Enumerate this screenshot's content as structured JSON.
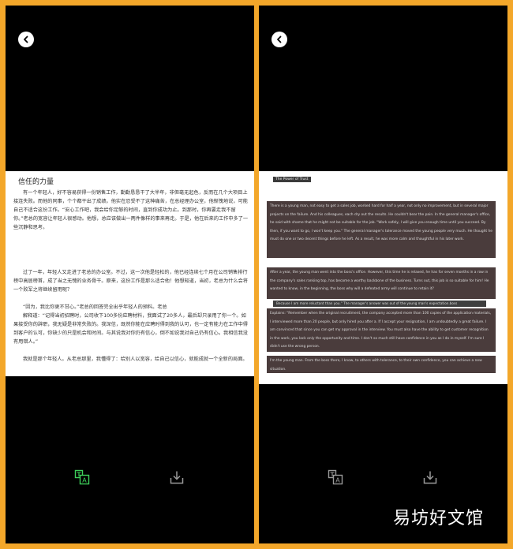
{
  "left": {
    "doc_title": "信任的力量",
    "paragraphs": [
      "有一个年轻人，好不容易获得一份销售工作，勤勤恳恳干了大半年，非但毫无起色，反而在几个大项目上接连失败。而他的同事，个个都干出了成绩。他实在忍受不了这种痛苦，在总经理办公室，他惭愧地说，可能自己不适合这份工作。“安心工作吧，我会给你足够的时间，直到你成功为止。到那时，你再要走我不留你。”老总的宽容让年轻人很感动。他想，总应该做出一两件像样的事来再走。于是，他在后来的工作中多了一些沉静和思考。",
      "过了一年，年轻人又走进了老总的办公室。不过，这一次他是轻松的，他已经连续七个月在公司销售排行榜中高居榜首，成了当之无愧的业务骨干。原来，这份工作是那么适合他！他想知道，当初，老总为什么会将一个败军之将继续留用呢？",
      "“因为，我比你更不甘心。”老总的回答完全出乎年轻人的预料。老总",
      "解释道：“记得当初招聘时，公司收下100多份应聘材料，我面试了20多人，最后却只录用了你一个。如果接受你的辞职，我无疑是非常失败的。我深信，既然你能在应聘时得到我的认可，也一定有能力在工作中得到客户的认可，你缺少的只是机会和时间。与其说我对你仍有信心，倒不如说我对自己仍有信心。我相信我没有用错人。”",
      "我就是那个年轻人。从老总那里，我懂得了：给别人以宽容，给自己以信心，就能成就一个全新的局面。"
    ]
  },
  "right": {
    "doc_title": "The Power of Trust",
    "blocks": [
      "There is a young man, not easy to get a sales job, worked hard for half a year, not only no improvement, but in several major projects on the failure. And his colleagues, each dry out the results. He couldn't bear the pain. In the general manager's office, he said with shame that he might not be suitable for the job. \"Work safely, I will give you enough time until you succeed. By then, if you want to go, I won't keep you.\" The general manager's tolerance moved the young people very much. He thought he must do one or two decent things before he left. As a result, he was more calm and thoughtful in his later work.",
      "After a year, the young man went into the boss's office. However, this time he is relaxed, he has for seven months in a row in the company's sales ranking top, has become a worthy backbone of the business. Turns out, this job is so suitable for him! He wanted to know, in the beginning, the boss why will a defeated army will continue to retain it?",
      "Because I am more reluctant than you.\" The manager's answer was out of the young man's expectation.boss",
      "Explains: \"Remember when the original recruitment, the company accepted more than 100 copies of the application materials, I interviewed more than 20 people, but only hired you after a. If I accept your resignation, I am undoubtedly a great failure. I am convinced that since you can get my approval in the interview. You must also have the ability to get customer recognition in the work, you lack only the opportunity and time. I don't so much still have confidence in you as I do in myself. I'm sure I didn't use the wrong person.",
      "I'm the young man. From the boss there, I know, to others with tolerance, to their own confidence, you can achieve a new situation."
    ]
  },
  "icons": {
    "back": "chevron-left-icon",
    "translate": "translate-icon",
    "download": "download-icon"
  },
  "colors": {
    "frame": "#f3a72a",
    "translate_active": "#3ecf5a",
    "icon_gray": "#9a9a9a"
  },
  "watermark": "易坊好文馆"
}
